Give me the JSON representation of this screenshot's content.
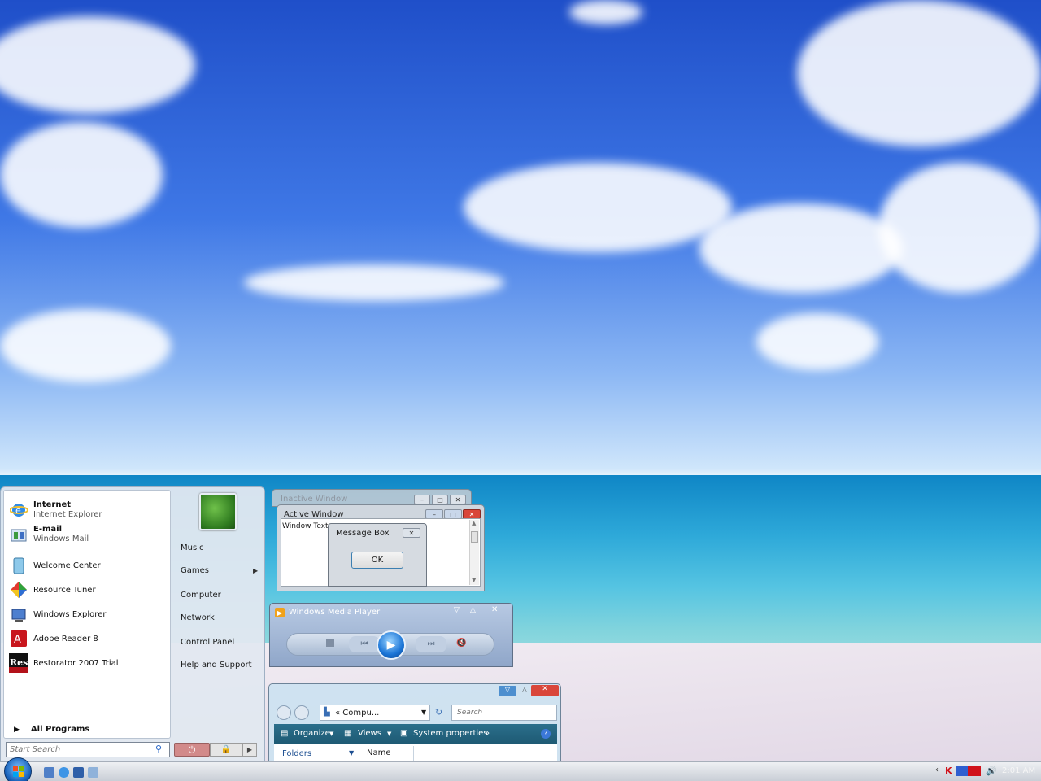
{
  "start_menu": {
    "pinned": [
      {
        "title": "Internet",
        "subtitle": "Internet Explorer"
      },
      {
        "title": "E-mail",
        "subtitle": "Windows Mail"
      }
    ],
    "recent": [
      "Welcome Center",
      "Resource Tuner",
      "Windows Explorer",
      "Adobe Reader 8",
      "Restorator 2007 Trial"
    ],
    "all_programs": "All Programs",
    "search_placeholder": "Start Search",
    "right_links": [
      "Music",
      "Games",
      "Computer",
      "Network",
      "Control Panel",
      "Help and Support"
    ]
  },
  "windows": {
    "inactive_title": "Inactive Window",
    "active_title": "Active Window",
    "window_text": "Window Text",
    "message_box_title": "Message Box",
    "ok_label": "OK",
    "media_player_title": "Windows Media Player"
  },
  "explorer": {
    "address": "« Compu...",
    "search_placeholder": "Search",
    "organize": "Organize",
    "views": "Views",
    "system_properties": "System properties",
    "folders": "Folders",
    "name_column": "Name"
  },
  "taskbar": {
    "clock": "2:01 AM"
  },
  "colors": {
    "toolbar": "#2b6f8c",
    "start_orb": "#165fb8",
    "close_button": "#d9463a"
  }
}
